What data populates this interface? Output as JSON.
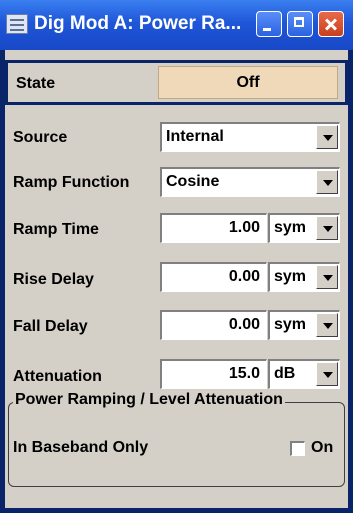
{
  "window": {
    "title": "Dig Mod  A: Power Ra...",
    "icons": [
      "window-menu-icon",
      "minimize-icon",
      "maximize-icon",
      "close-icon"
    ]
  },
  "state": {
    "label": "State",
    "value": "Off"
  },
  "source": {
    "label": "Source",
    "value": "Internal"
  },
  "ramp_function": {
    "label": "Ramp Function",
    "value": "Cosine"
  },
  "ramp_time": {
    "label": "Ramp Time",
    "value": "1.00",
    "unit": "sym"
  },
  "rise_delay": {
    "label": "Rise Delay",
    "value": "0.00",
    "unit": "sym"
  },
  "fall_delay": {
    "label": "Fall Delay",
    "value": "0.00",
    "unit": "sym"
  },
  "attenuation": {
    "label": "Attenuation",
    "value": "15.0",
    "unit": "dB"
  },
  "group": {
    "title": "Power Ramping / Level Attenuation",
    "baseband_label": "In Baseband Only",
    "checkbox_label": "On",
    "checked": false
  },
  "colors": {
    "titlebar": "#1f56d8",
    "panel": "#d4d0c8",
    "state_button": "#efd9b8",
    "focus_border": "#0a246a"
  }
}
